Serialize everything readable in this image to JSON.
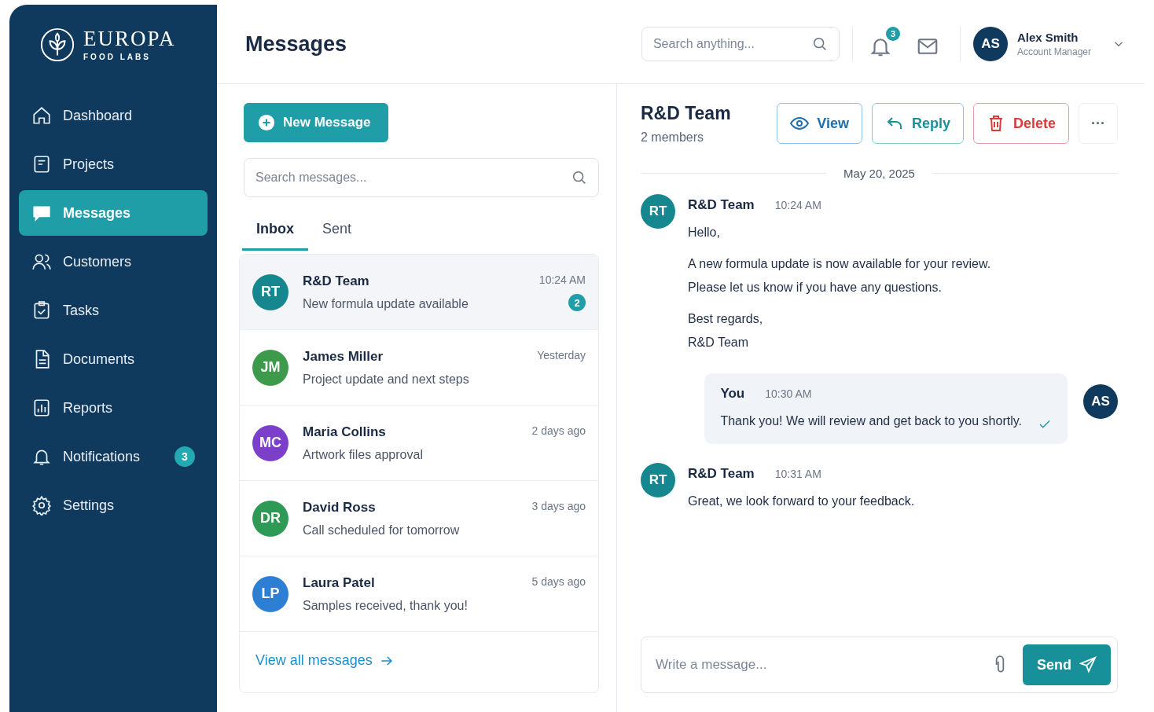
{
  "brand": {
    "name": "EUROPA",
    "tagline": "FOOD LABS"
  },
  "sidebar": {
    "items": [
      {
        "label": "Dashboard",
        "selected": false
      },
      {
        "label": "Projects",
        "selected": false
      },
      {
        "label": "Messages",
        "selected": true
      },
      {
        "label": "Customers",
        "selected": false
      },
      {
        "label": "Tasks",
        "selected": false
      },
      {
        "label": "Documents",
        "selected": false
      },
      {
        "label": "Reports",
        "selected": false
      },
      {
        "label": "Notifications",
        "selected": false,
        "badge": "3"
      },
      {
        "label": "Settings",
        "selected": false
      }
    ]
  },
  "header": {
    "title": "Messages",
    "search": {
      "placeholder": "Search anything..."
    },
    "notification_count": "3",
    "user": {
      "initials": "AS",
      "name": "Alex Smith",
      "role": "Account Manager"
    }
  },
  "inbox": {
    "new_button": "New Message",
    "search": {
      "placeholder": "Search messages..."
    },
    "tabs": [
      {
        "label": "Inbox",
        "selected": true
      },
      {
        "label": "Sent",
        "selected": false
      }
    ],
    "conversations": [
      {
        "initials": "RT",
        "color": "#16868f",
        "name": "R&D Team",
        "preview": "New formula update available",
        "time": "10:24 AM",
        "unread": "2",
        "selected": true
      },
      {
        "initials": "JM",
        "color": "#3d9a4a",
        "name": "James Miller",
        "preview": "Project update and next steps",
        "time": "Yesterday",
        "selected": false
      },
      {
        "initials": "MC",
        "color": "#7b3fc9",
        "name": "Maria Collins",
        "preview": "Artwork files approval",
        "time": "2 days ago",
        "selected": false
      },
      {
        "initials": "DR",
        "color": "#2f9a55",
        "name": "David Ross",
        "preview": "Call scheduled for tomorrow",
        "time": "3 days ago",
        "selected": false
      },
      {
        "initials": "LP",
        "color": "#2d7fd3",
        "name": "Laura Patel",
        "preview": "Samples received, thank you!",
        "time": "5 days ago",
        "selected": false
      }
    ],
    "view_all": "View all messages"
  },
  "chat": {
    "title": "R&D Team",
    "subtitle": "2 members",
    "buttons": [
      {
        "kind": "view",
        "label": "View"
      },
      {
        "kind": "reply",
        "label": "Reply"
      },
      {
        "kind": "delete",
        "label": "Delete"
      },
      {
        "kind": "more",
        "label": "···"
      }
    ],
    "date": "May 20, 2025",
    "messages": [
      {
        "kind": "incoming",
        "initials": "RT",
        "sender": "R&D Team",
        "time": "10:24 AM",
        "paragraphs": [
          "Hello,",
          "A new formula update is now available for your review.\nPlease let us know if you have any questions.",
          "Best regards,\nR&D Team"
        ]
      },
      {
        "kind": "outgoing",
        "initials": "AS",
        "sender": "You",
        "time": "10:30 AM",
        "paragraphs": [
          "Thank you! We will review and get back to you shortly."
        ],
        "read": true
      },
      {
        "kind": "incoming",
        "initials": "RT",
        "sender": "R&D Team",
        "time": "10:31 AM",
        "paragraphs": [
          "Great, we look forward to your feedback."
        ]
      }
    ],
    "composer": {
      "placeholder": "Write a message...",
      "send": "Send"
    }
  }
}
